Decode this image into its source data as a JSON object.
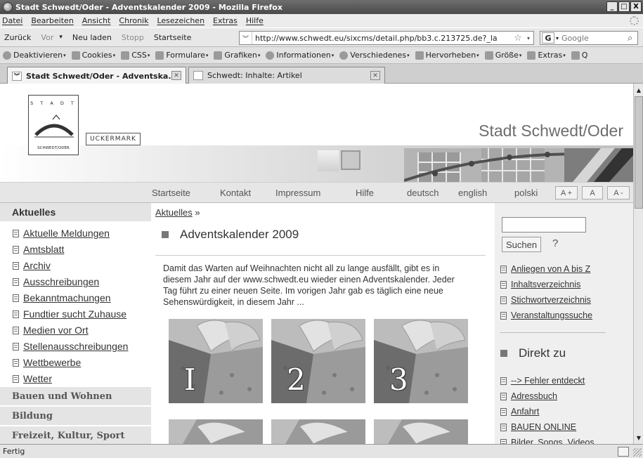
{
  "window": {
    "title": "Stadt Schwedt/Oder - Adventskalender 2009 - Mozilla Firefox",
    "buttons": [
      "_",
      "□",
      "X"
    ]
  },
  "menu": [
    "Datei",
    "Bearbeiten",
    "Ansicht",
    "Chronik",
    "Lesezeichen",
    "Extras",
    "Hilfe"
  ],
  "nav": {
    "back": "Zurück",
    "forward": "Vor",
    "forward_arrow": "▾",
    "reload": "Neu laden",
    "stop": "Stopp",
    "home": "Startseite",
    "url": "http://www.schwedt.eu/sixcms/detail.php/bb3.c.213725.de?_la",
    "search_placeholder": "Google"
  },
  "devbar": [
    "Deaktivieren",
    "Cookies",
    "CSS",
    "Formulare",
    "Grafiken",
    "Informationen",
    "Verschiedenes",
    "Hervorheben",
    "Größe",
    "Extras",
    "Q"
  ],
  "tabs": [
    {
      "label": "Stadt Schwedt/Oder - Adventska..."
    },
    {
      "label": "Schwedt: Inhalte: Artikel"
    }
  ],
  "site": {
    "logo_top": "S T A D T",
    "logo_bottom": "SCHWEDT/ODER",
    "uckermark": "UCKERMARK",
    "title": "Stadt Schwedt/Oder"
  },
  "topnav": {
    "items": [
      "Startseite",
      "Kontakt",
      "Impressum",
      "Hilfe",
      "deutsch",
      "english",
      "polski"
    ],
    "font_buttons": [
      "A +",
      "A",
      "A -"
    ]
  },
  "left": {
    "section_active": "Aktuelles",
    "items": [
      "Aktuelle Meldungen",
      "Amtsblatt",
      "Archiv",
      "Ausschreibungen",
      "Bekanntmachungen",
      "Fundtier sucht Zuhause",
      "Medien vor Ort",
      "Stellenausschreibungen",
      "Wettbewerbe",
      "Wetter"
    ],
    "sections": [
      "Bauen und Wohnen",
      "Bildung",
      "Freizeit, Kultur, Sport"
    ]
  },
  "main": {
    "breadcrumb_link": "Aktuelles",
    "breadcrumb_sep": "»",
    "heading": "Adventskalender 2009",
    "intro": "Damit das Warten auf Weihnachten nicht all zu lange ausfällt, gibt es in diesem Jahr auf der www.schwedt.eu wieder einen Adventskalender. Jeder Tag führt zu einer neuen Seite. Im vorigen Jahr gab es täglich eine neue Sehenswürdigkeit, in diesem Jahr ...",
    "tiles": [
      "I",
      "2",
      "3"
    ]
  },
  "right": {
    "search_button": "Suchen",
    "help": "?",
    "links": [
      "Anliegen von A bis Z",
      "Inhaltsverzeichnis",
      "Stichwortverzeichnis",
      "Veranstaltungssuche"
    ],
    "direkt_heading": "Direkt zu",
    "direkt_links": [
      "--> Fehler entdeckt",
      "Adressbuch",
      "Anfahrt",
      "BAUEN ONLINE",
      "Bilder, Songs, Videos"
    ]
  },
  "status": "Fertig"
}
